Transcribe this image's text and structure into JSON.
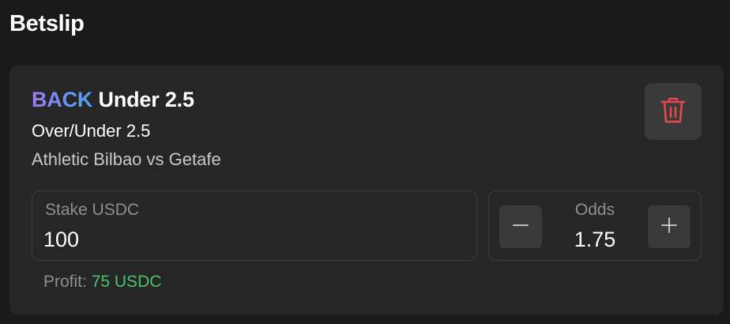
{
  "page": {
    "title": "Betslip"
  },
  "bet": {
    "side": "BACK",
    "selection": "Under 2.5",
    "market": "Over/Under 2.5",
    "event": "Athletic Bilbao vs Getafe"
  },
  "stake": {
    "label": "Stake USDC",
    "value": "100"
  },
  "odds": {
    "label": "Odds",
    "value": "1.75",
    "decrement_icon": "minus-icon",
    "increment_icon": "plus-icon"
  },
  "profit": {
    "label": "Profit:",
    "value": "75 USDC"
  },
  "delete": {
    "icon": "trash-icon"
  },
  "colors": {
    "background": "#1a1a1a",
    "card": "#262626",
    "button": "#3a3a3a",
    "side_gradient_start": "#9d7cf0",
    "side_gradient_end": "#4aa3f5",
    "delete_icon": "#e5484d",
    "profit_value": "#4cc46a",
    "muted_text": "#8f8f8f"
  }
}
